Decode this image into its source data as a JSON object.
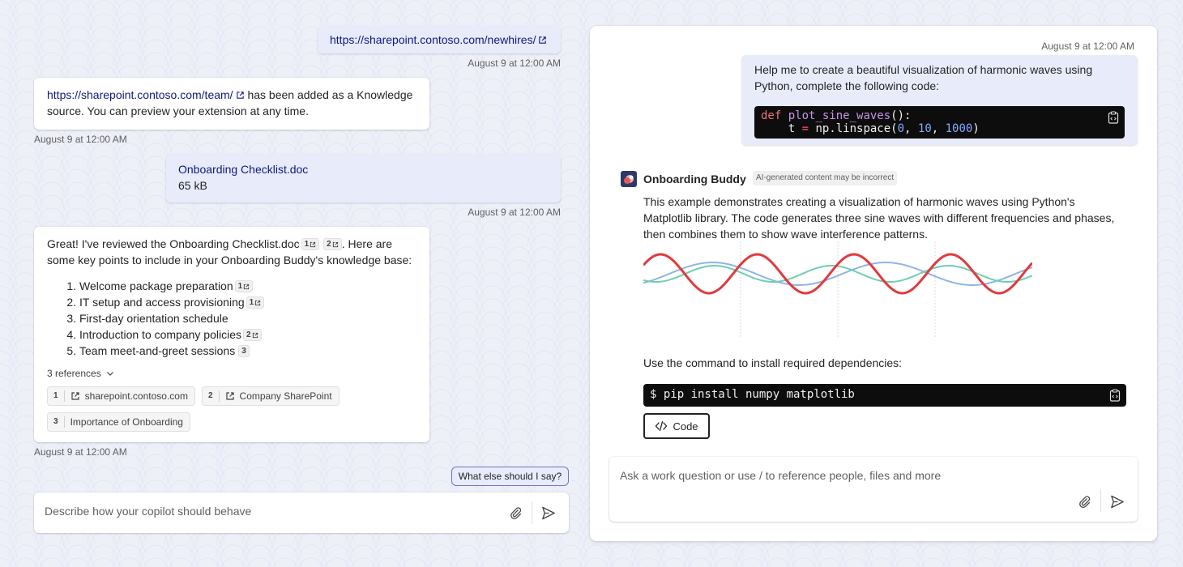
{
  "left": {
    "msg1": {
      "link": "https://sharepoint.contoso.com/newhires/",
      "timestamp": "August 9 at 12:00 AM"
    },
    "msg2": {
      "link": "https://sharepoint.contoso.com/team/",
      "text1": " has been added as a Knowledge",
      "text2": "source. You can preview your extension at any time.",
      "timestamp": "August 9 at 12:00 AM"
    },
    "msg3": {
      "file_name": "Onboarding Checklist.doc",
      "file_size": "65 kB",
      "timestamp": "August 9 at 12:00 AM"
    },
    "msg4": {
      "intro_a": "Great! I've reviewed the Onboarding Checklist.doc",
      "intro_b": ". Here are",
      "intro_c": "some key points to include in your Onboarding Buddy's knowledge base:",
      "cite1": "1",
      "cite2": "2",
      "points": [
        {
          "text": "Welcome package preparation",
          "cite": "1"
        },
        {
          "text": "IT setup and access provisioning",
          "cite": "1"
        },
        {
          "text": "First-day orientation schedule",
          "cite": ""
        },
        {
          "text": "Introduction to company policies",
          "cite": "2"
        },
        {
          "text": "Team meet-and-greet sessions",
          "cite": "3"
        }
      ],
      "refs_toggle": "3 references",
      "refs": [
        {
          "num": "1",
          "label": "sharepoint.contoso.com",
          "icon": "external-link-icon"
        },
        {
          "num": "2",
          "label": "Company SharePoint",
          "icon": "external-link-icon"
        },
        {
          "num": "3",
          "label": "Importance of Onboarding",
          "icon": ""
        }
      ],
      "timestamp": "August 9 at 12:00 AM"
    },
    "suggestion": "What else should I say?",
    "input": {
      "placeholder": "Describe how your copilot should behave"
    }
  },
  "right": {
    "user_msg": {
      "timestamp": "August 9 at 12:00 AM",
      "line1": "Help me to create a beautiful visualization of harmonic waves using",
      "line2": "Python, complete the following code:",
      "code": {
        "l1_kw": "def",
        "l1_fn": "plot_sine_waves",
        "l1_rest": "():",
        "l2_a": "    t ",
        "l2_op": "=",
        "l2_b": " np.linspace(",
        "l2_n1": "0",
        "l2_sep1": ", ",
        "l2_n2": "10",
        "l2_sep2": ", ",
        "l2_n3": "1000",
        "l2_end": ")"
      }
    },
    "bot": {
      "name": "Onboarding Buddy",
      "badge": "AI-generated content may be incorrect",
      "para1": "This example demonstrates creating a visualization of harmonic waves using Python's",
      "para2": "Matplotlib library. The code generates three sine waves with different frequencies and phases,",
      "para3": "then combines them to show wave interference patterns.",
      "install_text": "Use the command to install required dependencies:",
      "install_cmd": "$ pip install numpy matplotlib",
      "code_button": "Code"
    },
    "input": {
      "placeholder": "Ask a work question or use / to reference people, files and more"
    },
    "wave_colors": {
      "combined": "#e03a3e",
      "wave_a": "#8fb4e8",
      "wave_b": "#6fcfb0"
    }
  }
}
